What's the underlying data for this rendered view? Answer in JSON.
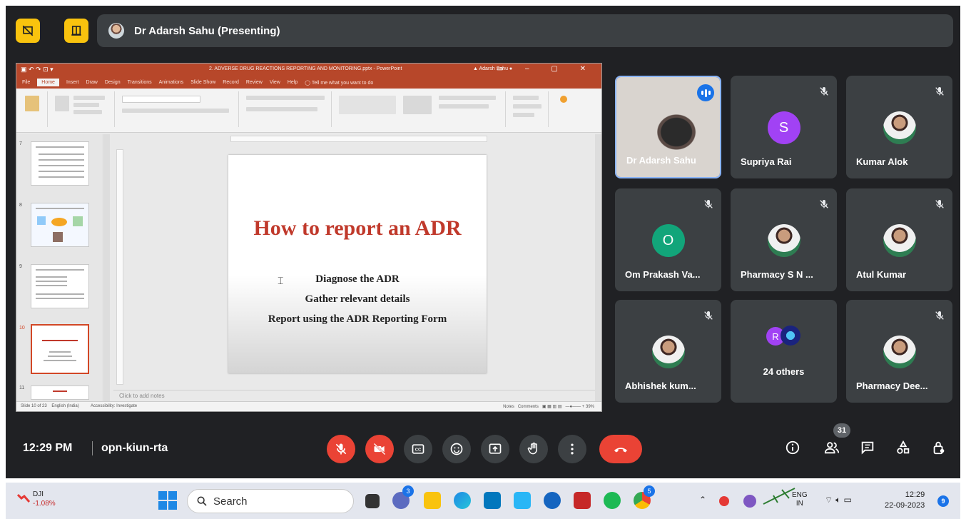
{
  "meeting": {
    "presenter_label": "Dr Adarsh Sahu (Presenting)",
    "time": "12:29 PM",
    "code": "opn-kiun-rta",
    "participant_count": "31"
  },
  "slide": {
    "title": "How to report an ADR",
    "bullets": [
      "Diagnose the ADR",
      "Gather relevant details",
      "Report using the ADR Reporting Form"
    ],
    "notes_placeholder": "Click to add notes"
  },
  "participants": [
    {
      "name": "Dr Adarsh Sahu",
      "kind": "camera",
      "speaking": true
    },
    {
      "name": "Supriya Rai",
      "kind": "initial",
      "initial": "S",
      "color": "#a142f4",
      "muted": true
    },
    {
      "name": "Kumar Alok",
      "kind": "photo",
      "muted": true
    },
    {
      "name": "Om Prakash Va...",
      "kind": "initial",
      "initial": "O",
      "color": "#12a57a",
      "muted": true
    },
    {
      "name": "Pharmacy S N ...",
      "kind": "photo",
      "muted": true
    },
    {
      "name": "Atul Kumar",
      "kind": "photo",
      "muted": true
    },
    {
      "name": "Abhishek kum...",
      "kind": "photo",
      "muted": true
    },
    {
      "name": "24 others",
      "kind": "group",
      "initial": "R"
    },
    {
      "name": "Pharmacy Dee...",
      "kind": "photo",
      "muted": true
    }
  ],
  "taskbar": {
    "stock_name": "DJI",
    "stock_change": "-1.08%",
    "search_placeholder": "Search",
    "lang_top": "ENG",
    "lang_bottom": "IN",
    "clock_time": "12:29",
    "clock_date": "22-09-2023",
    "notification_count": "9",
    "chrome_badge": "5",
    "store_badge": "3"
  },
  "colors": {
    "meet_bg": "#202124",
    "tile_bg": "#3c4043",
    "accent_red": "#ea4335",
    "present_yellow": "#f9c30e",
    "ppt_red": "#b7472a",
    "slide_title_red": "#c0392b"
  }
}
